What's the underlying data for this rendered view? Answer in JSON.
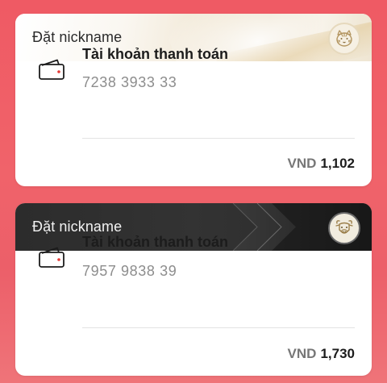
{
  "accounts": [
    {
      "nickname_label": "Đặt nickname",
      "badge_icon": "tiger-icon",
      "account_type": "Tài khoản thanh toán",
      "account_number": "7238 3933 33",
      "currency": "VND",
      "balance": "1,102",
      "theme": "gold"
    },
    {
      "nickname_label": "Đặt nickname",
      "badge_icon": "ox-icon",
      "account_type": "Tài khoản thanh toán",
      "account_number": "7957 9838 39",
      "currency": "VND",
      "balance": "1,730",
      "theme": "black"
    }
  ],
  "colors": {
    "background": "#ef5a64",
    "card": "#ffffff",
    "gold_header": "#efe6d3",
    "black_header": "#2c2c2c",
    "wallet_accent": "#e53935",
    "muted_text": "#8d8d8d"
  }
}
